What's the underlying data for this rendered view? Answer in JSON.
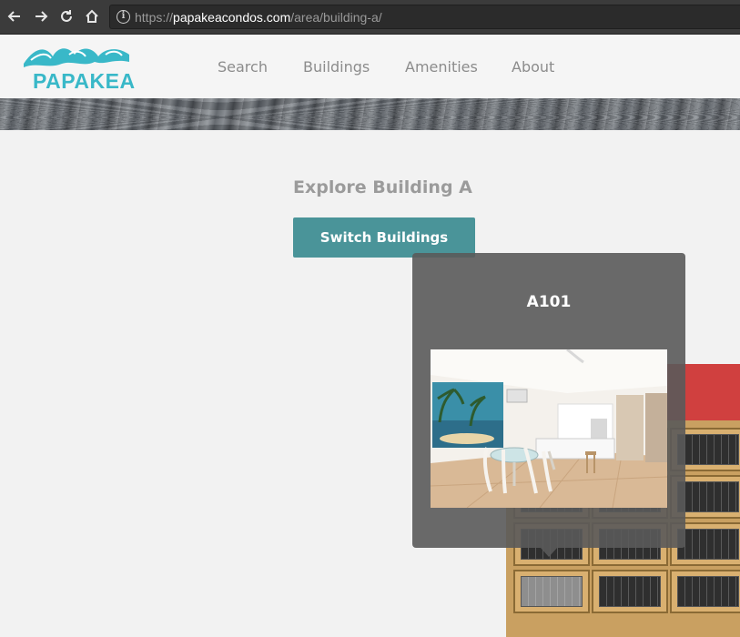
{
  "browser": {
    "url_prefix": "https://",
    "url_domain": "papakeacondos.com",
    "url_path": "/area/building-a/",
    "icons": [
      "back-arrow-icon",
      "forward-arrow-icon",
      "reload-icon",
      "home-icon",
      "info-icon"
    ]
  },
  "site": {
    "logo_text": "PAPAKEA",
    "brand_color": "#39b8c8",
    "nav": [
      "Search",
      "Buildings",
      "Amenities",
      "About"
    ]
  },
  "main": {
    "title": "Explore Building A",
    "switch_label": "Switch Buildings",
    "accent_color": "#4a9499"
  },
  "popup": {
    "unit_name": "A101"
  }
}
